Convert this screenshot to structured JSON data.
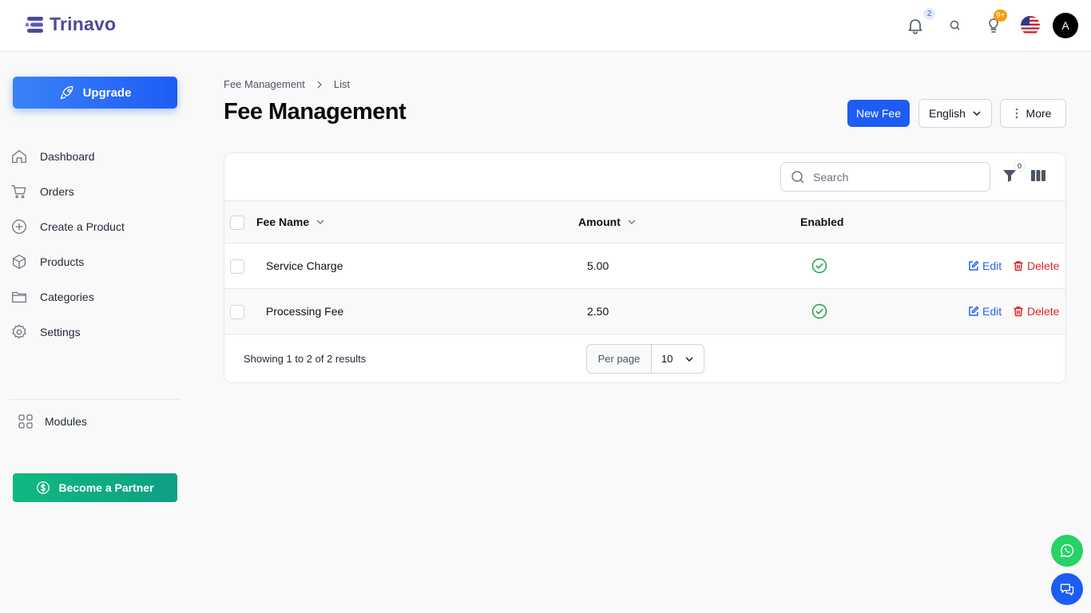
{
  "header": {
    "brand": "Trinavo",
    "notification_count": "2",
    "tips_count": "9+",
    "avatar_initial": "A"
  },
  "sidebar": {
    "upgrade_label": "Upgrade",
    "items": [
      {
        "label": "Dashboard",
        "icon": "home-icon"
      },
      {
        "label": "Orders",
        "icon": "cart-icon"
      },
      {
        "label": "Create a Product",
        "icon": "plus-circle-icon"
      },
      {
        "label": "Products",
        "icon": "box-icon"
      },
      {
        "label": "Categories",
        "icon": "folder-icon"
      },
      {
        "label": "Settings",
        "icon": "gear-icon"
      }
    ],
    "modules_label": "Modules",
    "partner_label": "Become a Partner"
  },
  "page": {
    "breadcrumb": [
      "Fee Management",
      "List"
    ],
    "title": "Fee Management",
    "new_button": "New Fee",
    "language": "English",
    "more_button": "More"
  },
  "table": {
    "search_placeholder": "Search",
    "filter_count": "0",
    "columns": [
      "Fee Name",
      "Amount",
      "Enabled"
    ],
    "rows": [
      {
        "name": "Service Charge",
        "amount": "5.00",
        "enabled": true,
        "edit": "Edit",
        "delete": "Delete"
      },
      {
        "name": "Processing Fee",
        "amount": "2.50",
        "enabled": true,
        "edit": "Edit",
        "delete": "Delete"
      }
    ],
    "summary": "Showing 1 to 2 of 2 results",
    "per_page_label": "Per page",
    "per_page_value": "10"
  },
  "colors": {
    "primary": "#1d5cf5",
    "success": "#16a34a",
    "danger": "#dc2626",
    "brand": "#4c4a9a"
  }
}
